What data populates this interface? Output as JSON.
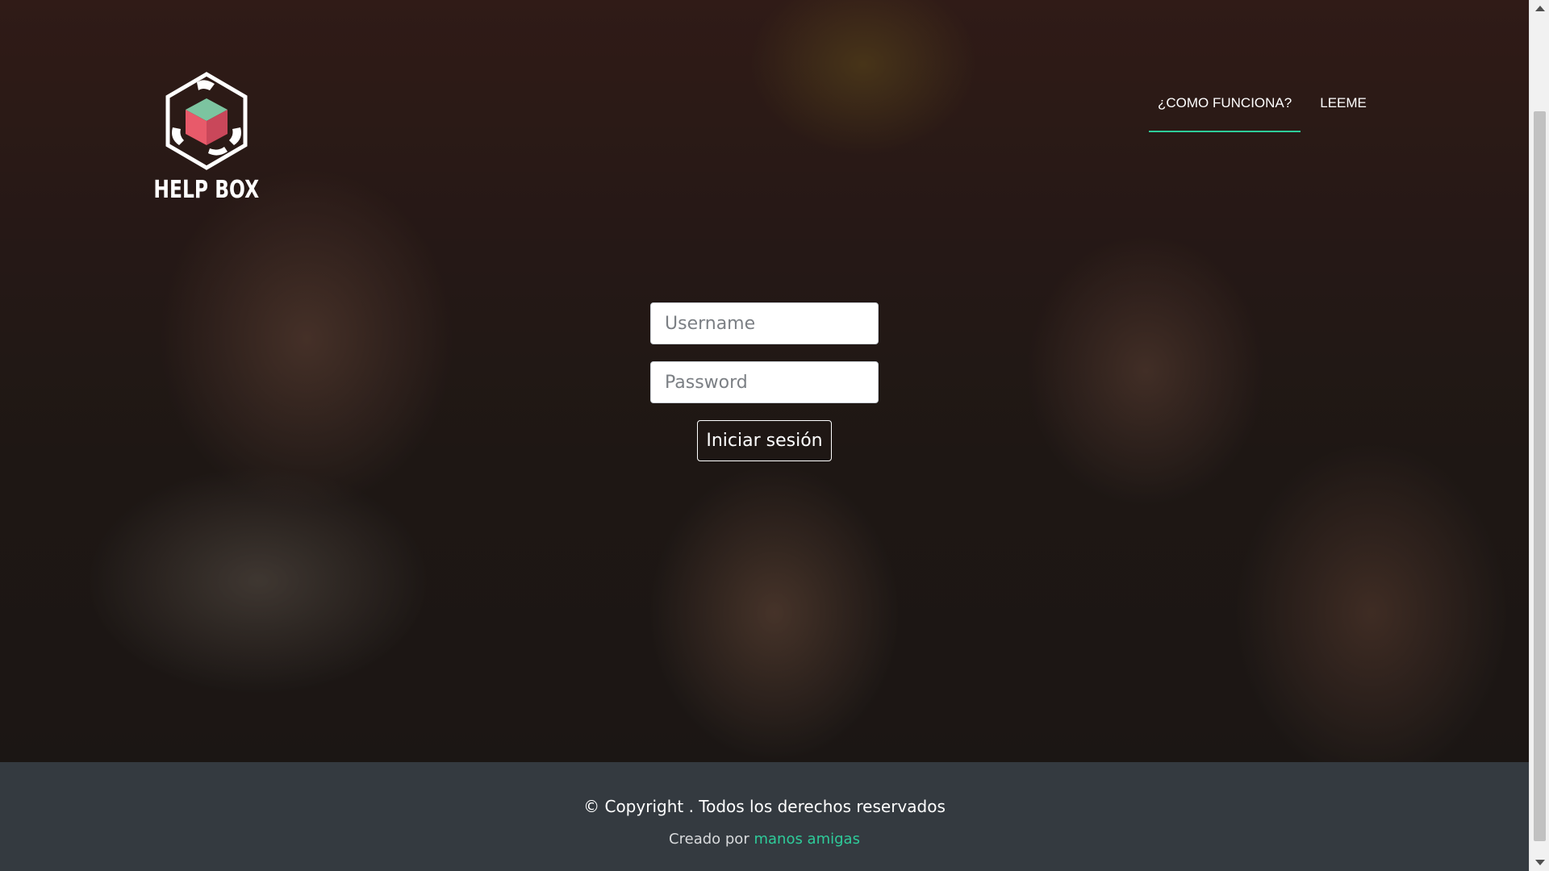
{
  "brand": {
    "name": "HELP BOX",
    "logo_icon": "hands-box-icon"
  },
  "nav": {
    "items": [
      {
        "label": "¿COMO FUNCIONA?",
        "active": true
      },
      {
        "label": "LEEME",
        "active": false
      }
    ],
    "accent_color": "#2ecc9a"
  },
  "login": {
    "username_placeholder": "Username",
    "username_value": "",
    "password_placeholder": "Password",
    "password_value": "",
    "submit_label": "Iniciar sesión"
  },
  "footer": {
    "copyright": "© Copyright . Todos los derechos reservados",
    "credit_prefix": "Creado por",
    "credit_link": "manos amigas",
    "background": "#343a40"
  }
}
